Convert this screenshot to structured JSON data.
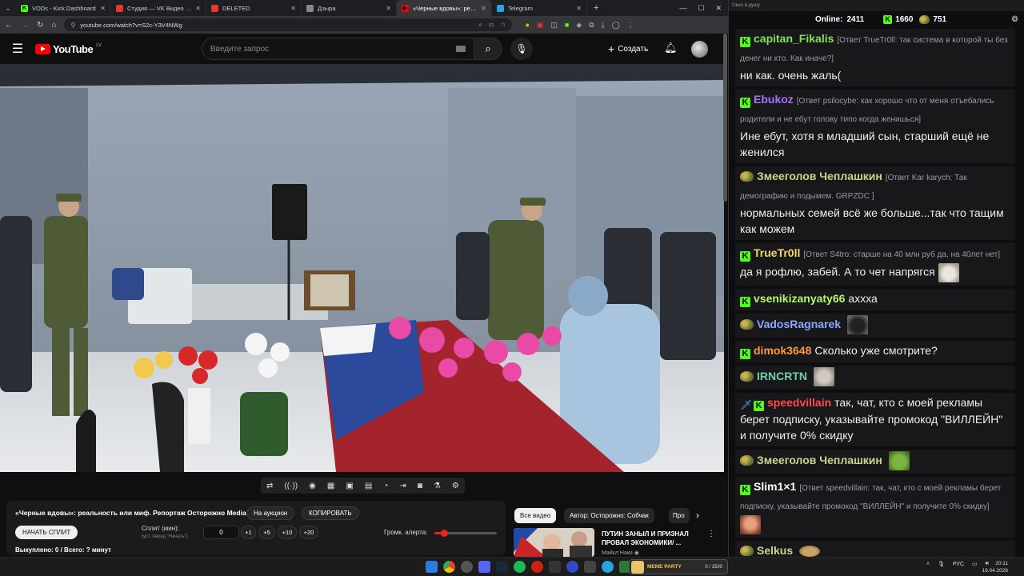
{
  "browser": {
    "tabs": [
      {
        "label": "VODs - Kick Dashboard",
        "color": "#53fc18",
        "glyph": "K",
        "active": false
      },
      {
        "label": "Студия — VK Видео Live",
        "color": "#e33",
        "glyph": "",
        "active": false
      },
      {
        "label": "DELETED",
        "color": "#e33",
        "glyph": "",
        "active": false
      },
      {
        "label": "Дзыра",
        "color": "#888",
        "glyph": "",
        "active": false
      },
      {
        "label": "«Черные вдовы»: реальн...",
        "color": "#f00",
        "glyph": "▶",
        "active": true
      },
      {
        "label": "Telegram",
        "color": "#2aa3e0",
        "glyph": "",
        "active": false
      }
    ],
    "url": "youtube.com/watch?v=S2c-Y3V4NWg"
  },
  "youtube": {
    "logo_text": "YouTube",
    "country_code": "LV",
    "search_placeholder": "Введите запрос",
    "create_label": "Создать"
  },
  "extension_toolbar": {
    "icons": [
      "loop-icon",
      "broadcast-icon",
      "theater-icon",
      "clapper-icon",
      "pip-icon",
      "subtitle-icon",
      "speed-icon",
      "chapter-icon",
      "camera-icon",
      "flask-icon",
      "gear-icon"
    ],
    "glyphs": [
      "⇄",
      "((·))",
      "◉",
      "▦",
      "▣",
      "▤",
      "◔",
      "⇥",
      "◙",
      "⚗",
      "⚙"
    ]
  },
  "info_panel": {
    "title": "«Черные вдовы»: реальность или миф. Репортаж Осторожно Media",
    "auction_label": "На аукцион",
    "copy_label": "КОПИРОВАТЬ",
    "split_button": "НАЧАТЬ СПЛИТ",
    "split_label": "Сплит (мин):",
    "split_hint": "(уст. перед \"Начать\")",
    "split_value": "0",
    "increment_buttons": [
      "+1",
      "+5",
      "+10",
      "+20"
    ],
    "alert_volume_label": "Громк. алерта:",
    "alert_volume": 0.15,
    "status_text": "Выкуплено: 0 / Всего: ? минут"
  },
  "related": {
    "chips": [
      "Все видео",
      "Автор: Осторожно: Собчак",
      "Про"
    ],
    "video": {
      "title": "ПУТИН ЗАНЫЛ И ПРИЗНАЛ ПРОВАЛ ЭКОНОМИКИ/ ...",
      "channel": "Майкл Наки"
    }
  },
  "chat": {
    "window_title": "Окно в душу",
    "online_label": "Online:",
    "online_count": "2411",
    "kick_count": "1660",
    "vk_count": "751",
    "messages": [
      {
        "badge": "kick",
        "user": "capitan_Fikalis",
        "color": "#7fe35a",
        "reply": "[Ответ TrueTr0ll: так система в которой ты без денег ни кто. Как иначе?]",
        "text": "ни как. очень жаль(",
        "emote": ""
      },
      {
        "badge": "kick",
        "user": "Ebukoz",
        "color": "#a970ff",
        "reply": "[Ответ psilocybe: как хорошо что от меня отъебались родители и не ебут голову типо когда женишься]",
        "text": "Ине ебут, хотя я младший сын, старший ещё не женился",
        "emote": ""
      },
      {
        "badge": "vk",
        "user": "Змееголов Чеплашкин",
        "color": "#c7d88a",
        "reply": "[Ответ Kar karych: Так демографию и подымем. GRPZDC ]",
        "text": "нормальных семей всё же больше...так что тащим как можем",
        "emote": ""
      },
      {
        "badge": "kick",
        "user": "TrueTr0ll",
        "color": "#f5d76e",
        "reply": "[Ответ S4tro: старше на 40 млн руб да, на 40лет нет]",
        "text": "да я рофлю, забей. А то чет напрягся",
        "emote": "cat"
      },
      {
        "badge": "kick",
        "user": "vsenikizanyaty66",
        "color": "#b5f76a",
        "reply": "",
        "text": "аххха",
        "emote": ""
      },
      {
        "badge": "vk",
        "user": "VadosRagnarek",
        "color": "#8fa8ff",
        "reply": "",
        "text": "",
        "emote": "blackcat"
      },
      {
        "badge": "kick",
        "user": "dimok3648",
        "color": "#ff9a3c",
        "reply": "",
        "text": "Сколько уже смотрите?",
        "emote": ""
      },
      {
        "badge": "vk",
        "user": "IRNCRTN",
        "color": "#6fd0a8",
        "reply": "",
        "text": "",
        "emote": "greycat"
      },
      {
        "badge": "sword-kick",
        "user": "speedvillain",
        "color": "#ff4b4b",
        "reply": "",
        "text": "так, чат, кто с моей рекламы берет подписку, указывайте промокод \"ВИЛЛЕЙН\" и получите 0% скидку",
        "emote": ""
      },
      {
        "badge": "vk",
        "user": "Змееголов Чеплашкин",
        "color": "#c7d88a",
        "reply": "",
        "text": "",
        "emote": "pepe"
      },
      {
        "badge": "kick",
        "user": "Slim1×1",
        "color": "#ffffff",
        "reply": "[Ответ speedvillain: так, чат, кто с моей рекламы берет подписку, указывайте промокод \"ВИЛЛЕЙН\" и получите 0% скидку]",
        "text": "",
        "emote": "face"
      },
      {
        "badge": "vk",
        "user": "Selkus",
        "color": "#c7d88a",
        "reply": "",
        "text": "",
        "emote": "bread"
      }
    ]
  },
  "taskbar": {
    "notice_text": "MEME PARTY",
    "notice_progress": "0 / 1500",
    "language": "РУС",
    "time": "20:11",
    "date": "19.04.2026"
  }
}
